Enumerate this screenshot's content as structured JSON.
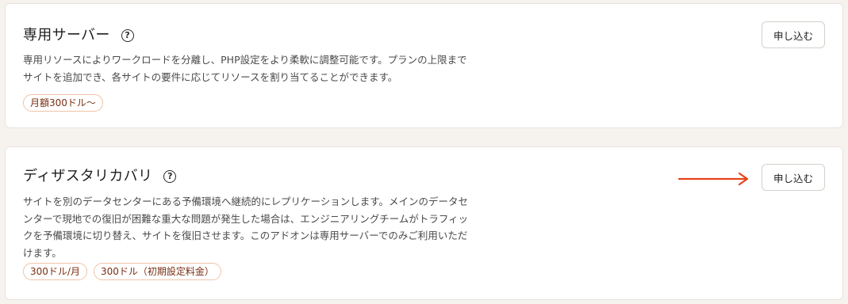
{
  "colors": {
    "page_bg": "#f6f3ef",
    "card_bg": "#ffffff",
    "tag_border": "#f0c3a8",
    "tag_text": "#7a2e12",
    "arrow": "#e8441a"
  },
  "addons": [
    {
      "title": "専用サーバー",
      "help_icon": "question-circle-icon",
      "description_lines": [
        "専用リソースによりワークロードを分離し、PHP設定をより柔軟に調整可能です。プランの上限まで",
        "サイトを追加でき、各サイトの要件に応じてリソースを割り当てることができます。"
      ],
      "tags": [
        "月額300ドル〜"
      ],
      "button_label": "申し込む"
    },
    {
      "title": "ディザスタリカバリ",
      "help_icon": "question-circle-icon",
      "description_lines": [
        "サイトを別のデータセンターにある予備環境へ継続的にレプリケーションします。メインのデータセ",
        "ンターで現地での復旧が困難な重大な問題が発生した場合は、エンジニアリングチームがトラフィッ",
        "クを予備環境に切り替え、サイトを復旧させます。このアドオンは専用サーバーでのみご利用いただ",
        "けます。"
      ],
      "tags": [
        "300ドル/月",
        "300ドル（初期設定料金）"
      ],
      "button_label": "申し込む"
    }
  ],
  "annotation": {
    "arrow_icon": "arrow-right-icon"
  }
}
